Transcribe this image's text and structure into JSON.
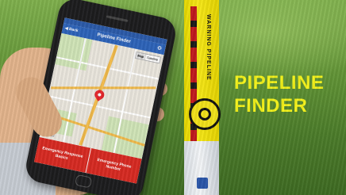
{
  "brand": {
    "line1": "PIPELINE",
    "line2": "FINDER"
  },
  "marker_post": {
    "text": "WARNING PIPELINE"
  },
  "app": {
    "nav": {
      "back_label": "◀ Back",
      "title": "Pipeline Finder",
      "settings_icon": "gear-icon"
    },
    "map": {
      "tabs": [
        "Map",
        "Satellite"
      ],
      "active_tab": "Map"
    },
    "buttons": {
      "emergency_response": "Emergency Response Basics",
      "emergency_phone": "Emergency Phone Number"
    }
  },
  "colors": {
    "brand_text": "#f4f21a",
    "nav_bar": "#2d63b8",
    "emergency": "#d62a22",
    "pin": "#e3262b"
  }
}
